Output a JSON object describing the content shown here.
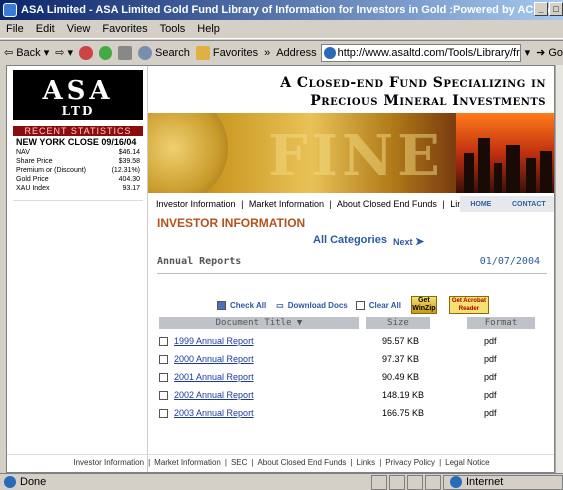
{
  "window": {
    "title": "ASA Limited - ASA Limited Gold Fund Library of Information for Investors in Gold :Powered by AC - Microsoft Internet Exp..."
  },
  "menu": [
    "File",
    "Edit",
    "View",
    "Favorites",
    "Tools",
    "Help"
  ],
  "toolbar": {
    "back": "Back",
    "search": "Search",
    "favorites": "Favorites",
    "address_label": "Address",
    "address_value": "http://www.asaltd.com/Tools/Library/frontend/item.asp",
    "go": "Go"
  },
  "sidebar": {
    "logo_main": "ASA",
    "logo_sub": "LTD",
    "stats_heading": "RECENT STATISTICS",
    "stats_title": "NEW YORK CLOSE 09/16/04",
    "stats": [
      {
        "label": "NAV",
        "value": "$46.14"
      },
      {
        "label": "Share Price",
        "value": "$39.58"
      },
      {
        "label": "Premium or (Discount)",
        "value": "(12.31%)"
      },
      {
        "label": "Gold Price",
        "value": "404.30"
      },
      {
        "label": "XAU Index",
        "value": "93.17"
      }
    ]
  },
  "hero": {
    "tagline1": "A Closed-end Fund Specializing in",
    "tagline2": "Precious Mineral Investments"
  },
  "nav": {
    "links": [
      "Investor Information",
      "|",
      "Market Information",
      "|",
      "About Closed End Funds",
      "|",
      "Links"
    ],
    "home": "HOME",
    "contact": "CONTACT"
  },
  "main": {
    "section_title": "INVESTOR INFORMATION",
    "all_categories": "All Categories",
    "next": "Next",
    "category": "Annual Reports",
    "date": "01/07/2004",
    "check_all": "Check All",
    "download_docs": "Download Docs",
    "clear_all": "Clear All",
    "winzip": "Get WinZip",
    "acrobat": "Get Acrobat Reader",
    "columns": [
      "Document Title ▼",
      "Size",
      "Format"
    ],
    "rows": [
      {
        "title": "1999 Annual Report",
        "size": "95.57 KB",
        "format": "pdf"
      },
      {
        "title": "2000 Annual Report",
        "size": "97.37 KB",
        "format": "pdf"
      },
      {
        "title": "2001 Annual Report",
        "size": "90.49 KB",
        "format": "pdf"
      },
      {
        "title": "2002 Annual Report",
        "size": "148.19 KB",
        "format": "pdf"
      },
      {
        "title": "2003 Annual Report",
        "size": "166.75 KB",
        "format": "pdf"
      }
    ]
  },
  "footer": [
    "Investor Information",
    "|",
    "Market Information",
    "|",
    "SEC",
    "|",
    "About Closed End Funds",
    "|",
    "Links",
    "|",
    "Privacy Policy",
    "|",
    "Legal Notice"
  ],
  "status": {
    "done": "Done",
    "zone": "Internet"
  }
}
